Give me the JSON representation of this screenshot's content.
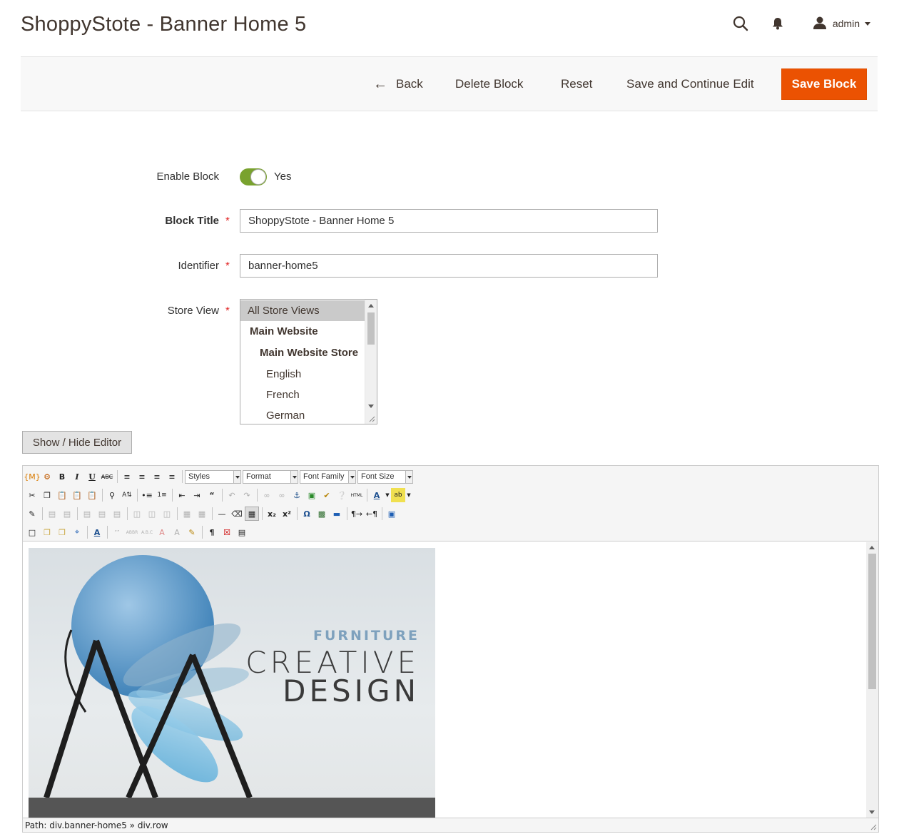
{
  "page": {
    "title": "ShoppyStote - Banner Home 5"
  },
  "header": {
    "user": "admin"
  },
  "actions": {
    "back": "Back",
    "delete": "Delete Block",
    "reset": "Reset",
    "save_continue": "Save and Continue Edit",
    "save": "Save Block",
    "accent": "#eb5202"
  },
  "form": {
    "enable": {
      "label": "Enable Block",
      "value": "Yes",
      "on": true,
      "color": "#79a22e"
    },
    "title": {
      "label": "Block Title",
      "required_mark": "*",
      "value": "ShoppyStote - Banner Home 5"
    },
    "identifier": {
      "label": "Identifier",
      "required_mark": "*",
      "value": "banner-home5"
    },
    "store_view": {
      "label": "Store View",
      "required_mark": "*",
      "options": [
        "All Store Views",
        "Main Website",
        "Main Website Store",
        "English",
        "French",
        "German"
      ],
      "selected": "All Store Views"
    }
  },
  "editor": {
    "toggle_button": "Show / Hide Editor",
    "selects": {
      "styles": "Styles",
      "format": "Format",
      "font_family": "Font Family",
      "font_size": "Font Size"
    },
    "banner": {
      "line1": "FURNITURE",
      "line2": "CREATIVE",
      "line3": "DESIGN"
    },
    "path": "Path: div.banner-home5 » div.row"
  }
}
